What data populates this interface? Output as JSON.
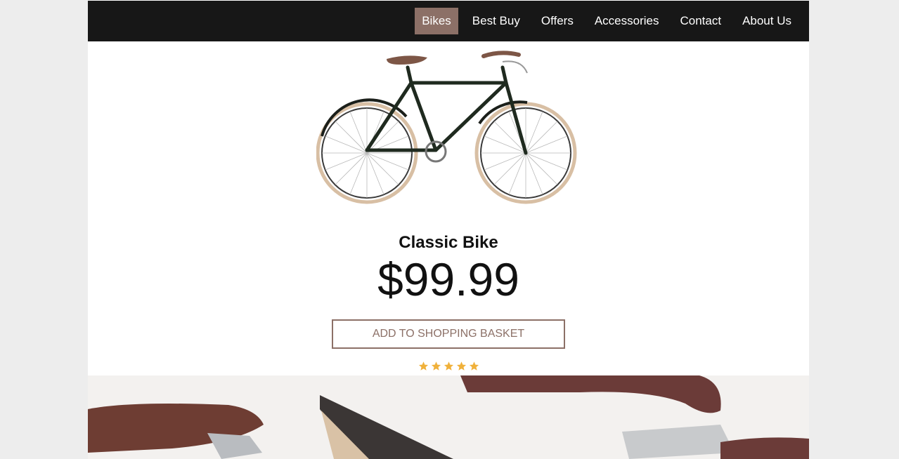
{
  "nav": {
    "items": [
      {
        "label": "Bikes",
        "active": true
      },
      {
        "label": "Best Buy"
      },
      {
        "label": "Offers"
      },
      {
        "label": "Accessories"
      },
      {
        "label": "Contact"
      },
      {
        "label": "About Us"
      }
    ]
  },
  "product": {
    "image_icon": "bicycle-image",
    "title": "Classic Bike",
    "price": "$99.99",
    "add_button_label": "ADD TO SHOPPING BASKET",
    "rating": 5,
    "rating_max": 5
  },
  "banner": {
    "image_icon": "bike-parts-banner-image"
  },
  "colors": {
    "nav_bg": "#171717",
    "accent": "#8c7067",
    "star": "#f0b13b",
    "page_bg": "#ededed"
  }
}
